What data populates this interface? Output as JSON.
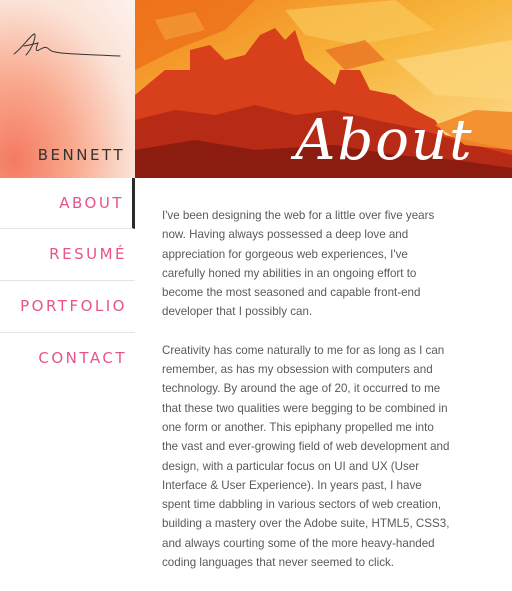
{
  "brand": {
    "name": "BENNETT",
    "logo_icon": "signature-logo"
  },
  "nav": {
    "items": [
      {
        "label": "ABOUT",
        "active": true
      },
      {
        "label": "RESUMÉ",
        "active": false
      },
      {
        "label": "PORTFOLIO",
        "active": false
      },
      {
        "label": "CONTACT",
        "active": false
      }
    ]
  },
  "hero": {
    "title": "About"
  },
  "content": {
    "paragraphs": [
      "I've been designing the web for a little over five years now. Having always possessed a deep love and appreciation for gorgeous web experiences, I've carefully honed my abilities in an ongoing effort to become the most seasoned and capable front-end developer that I possibly can.",
      "Creativity has come naturally to me for as long as I can remember, as has my obsession with computers and technology. By around the age of 20, it occurred to me that these two qualities were begging to be combined in one form or another. This epiphany propelled me into the vast and ever-growing field of web development and design, with a particular focus on UI and UX (User Interface & User Experience). In years past, I have spent time dabbling in various sectors of web creation, building a mastery over the Adobe suite, HTML5, CSS3, and always courting some of the more heavy-handed coding languages that never seemed to click."
    ]
  },
  "colors": {
    "accent": "#e8528d",
    "text": "#5a5a5a",
    "brand_text": "#333333"
  }
}
